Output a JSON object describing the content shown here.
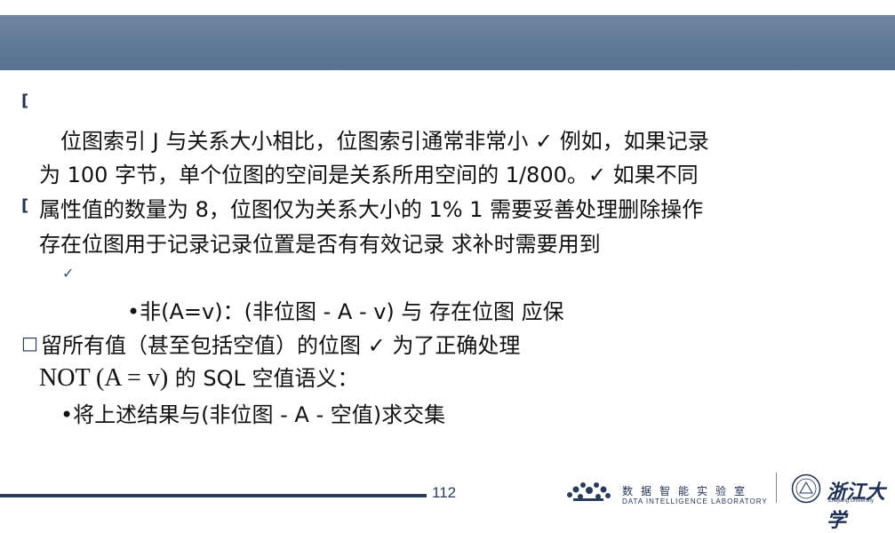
{
  "slide": {
    "lines": [
      "位图索引 J 与关系大小相比，位图索引通常非常小 ✓ 例如，如果记录",
      "为 100 字节，单个位图的空间是关系所用空间的 1/800。✓ 如果不同",
      "属性值的数量为 8，位图仅为关系大小的 1% 1 需要妥善处理删除操作",
      "存在位图用于记录记录位置是否有有效记录 求补时需要用到",
      "•非(A=v)：(非位图 - A - v) 与 存在位图 应保",
      "留所有值（甚至包括空值）的位图 ✓ 为了正确处理",
      "NOT (A = v)",
      " 的 SQL 空值语义：",
      "•将上述结果与(非位图 - A - 空值)求交集"
    ],
    "bullet_square_1": "[",
    "bullet_square_2": "[",
    "bullet_square_3": "□",
    "checkmark": "✓"
  },
  "footer": {
    "page_number": "112",
    "lab_name_cn": "数据智能实验室",
    "lab_name_en": "DATA INTELLIGENCE LABORATORY",
    "university_cn": "浙江大学",
    "university_en": "Zhejiang University"
  },
  "colors": {
    "header_bar": "#5e7895",
    "footer_bar": "#2a3b5c"
  }
}
